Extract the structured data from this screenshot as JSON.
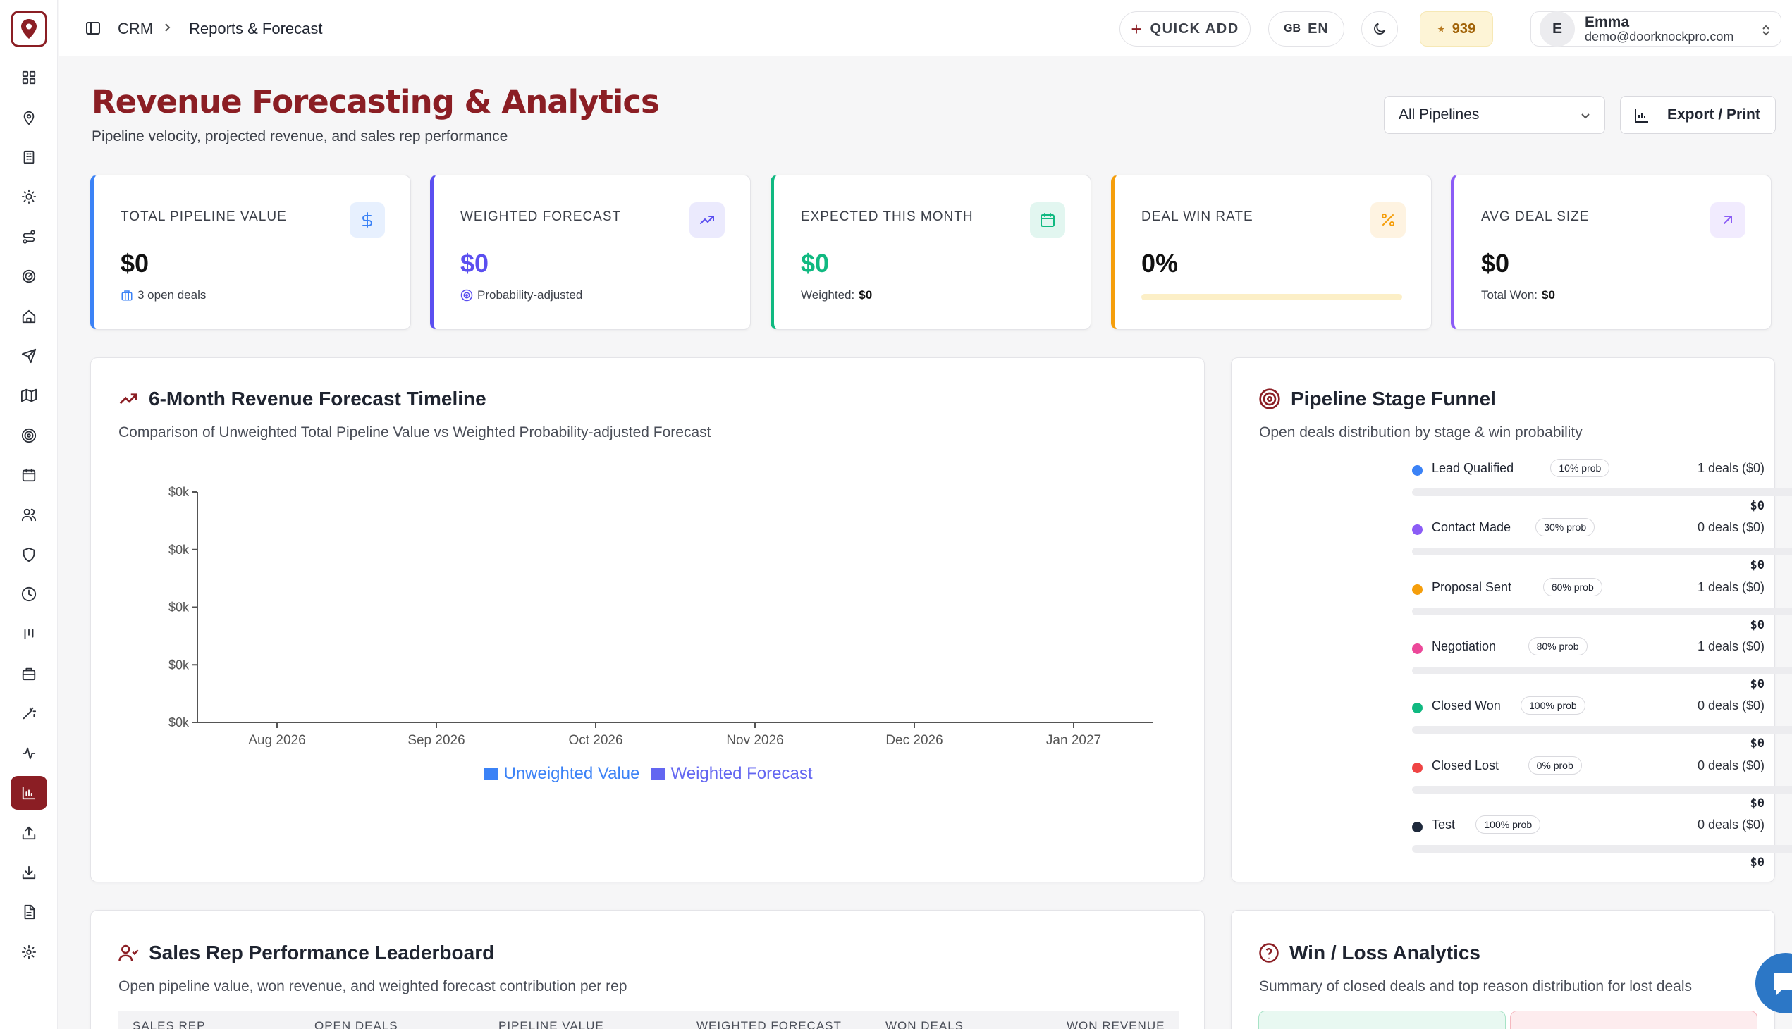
{
  "topbar": {
    "crumb_root": "CRM",
    "crumb_current": "Reports & Forecast",
    "quick_add": "QUICK ADD",
    "lang_flag": "GB",
    "lang_code": "EN",
    "credits": "939",
    "user_initial": "E",
    "user_name": "Emma",
    "user_email": "demo@doorknockpro.com"
  },
  "sidebar": {
    "items": [
      "dashboard",
      "map-pin",
      "building",
      "sun",
      "route",
      "radar",
      "home",
      "send",
      "map",
      "target",
      "calendar",
      "users",
      "shield",
      "clock",
      "kanban",
      "briefcase",
      "magic-wand",
      "activity",
      "bar-chart",
      "upload",
      "download",
      "file",
      "settings"
    ],
    "active": "bar-chart"
  },
  "header": {
    "title": "Revenue Forecasting & Analytics",
    "subtitle": "Pipeline velocity, projected revenue, and sales rep performance",
    "pipeline_select": "All Pipelines",
    "export_label": "Export / Print"
  },
  "kpis": [
    {
      "label": "TOTAL PIPELINE VALUE",
      "value": "$0",
      "sub": "3 open deals",
      "accent": "#3b82f6",
      "icon": "dollar-icon"
    },
    {
      "label": "WEIGHTED FORECAST",
      "value": "$0",
      "sub": "Probability-adjusted",
      "accent": "#5b4ff0",
      "icon": "trending-up-icon"
    },
    {
      "label": "EXPECTED THIS MONTH",
      "value": "$0",
      "sub_prefix": "Weighted:",
      "sub_value": "$0",
      "accent": "#10b981",
      "icon": "calendar-icon"
    },
    {
      "label": "DEAL WIN RATE",
      "value": "0%",
      "progress": 0,
      "accent": "#f59e0b",
      "icon": "percent-icon"
    },
    {
      "label": "AVG DEAL SIZE",
      "value": "$0",
      "sub_prefix": "Total Won:",
      "sub_value": "$0",
      "accent": "#8b5cf6",
      "icon": "arrow-up-right-icon"
    }
  ],
  "forecast": {
    "title": "6-Month Revenue Forecast Timeline",
    "subtitle": "Comparison of Unweighted Total Pipeline Value vs Weighted Probability-adjusted Forecast"
  },
  "chart_data": {
    "type": "bar",
    "title": "6-Month Revenue Forecast Timeline",
    "categories": [
      "Aug 2026",
      "Sep 2026",
      "Oct 2026",
      "Nov 2026",
      "Dec 2026",
      "Jan 2027"
    ],
    "y_ticks": [
      "$0k",
      "$0k",
      "$0k",
      "$0k",
      "$0k"
    ],
    "series": [
      {
        "name": "Unweighted Value",
        "values": [
          0,
          0,
          0,
          0,
          0,
          0
        ],
        "color": "#3b82f6"
      },
      {
        "name": "Weighted Forecast",
        "values": [
          0,
          0,
          0,
          0,
          0,
          0
        ],
        "color": "#6366f1"
      }
    ],
    "legend": "bottom",
    "grid": false
  },
  "funnel": {
    "title": "Pipeline Stage Funnel",
    "subtitle": "Open deals distribution by stage & win probability",
    "stages": [
      {
        "name": "Lead Qualified",
        "prob": "10% prob",
        "count": "1 deals ($0)",
        "amount": "$0",
        "color": "#3b82f6"
      },
      {
        "name": "Contact Made",
        "prob": "30% prob",
        "count": "0 deals ($0)",
        "amount": "$0",
        "color": "#8b5cf6"
      },
      {
        "name": "Proposal Sent",
        "prob": "60% prob",
        "count": "1 deals ($0)",
        "amount": "$0",
        "color": "#f59e0b"
      },
      {
        "name": "Negotiation",
        "prob": "80% prob",
        "count": "1 deals ($0)",
        "amount": "$0",
        "color": "#ec4899"
      },
      {
        "name": "Closed Won",
        "prob": "100% prob",
        "count": "0 deals ($0)",
        "amount": "$0",
        "color": "#10b981"
      },
      {
        "name": "Closed Lost",
        "prob": "0% prob",
        "count": "0 deals ($0)",
        "amount": "$0",
        "color": "#ef4444"
      },
      {
        "name": "Test",
        "prob": "100% prob",
        "count": "0 deals ($0)",
        "amount": "$0",
        "color": "#1e293b"
      }
    ]
  },
  "leaderboard": {
    "title": "Sales Rep Performance Leaderboard",
    "subtitle": "Open pipeline value, won revenue, and weighted forecast contribution per rep",
    "columns": [
      "SALES REP",
      "OPEN DEALS",
      "PIPELINE VALUE",
      "WEIGHTED FORECAST",
      "WON DEALS",
      "WON REVENUE"
    ]
  },
  "winloss": {
    "title": "Win / Loss Analytics",
    "subtitle": "Summary of closed deals and top reason distribution for lost deals"
  }
}
